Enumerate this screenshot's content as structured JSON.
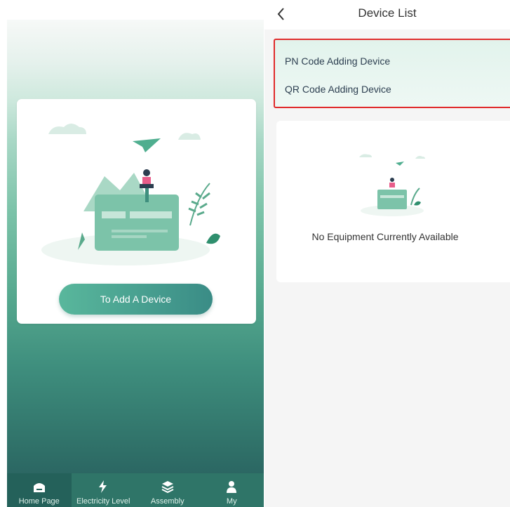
{
  "home": {
    "add_device_label": "To Add A Device",
    "tabs": [
      {
        "label": "Home Page",
        "icon": "home-icon",
        "active": true
      },
      {
        "label": "Electricity Level",
        "icon": "lightning-icon",
        "active": false
      },
      {
        "label": "Assembly",
        "icon": "layers-icon",
        "active": false
      },
      {
        "label": "My",
        "icon": "user-icon",
        "active": false
      }
    ]
  },
  "device_list": {
    "title": "Device List",
    "back_icon": "chevron-left-icon",
    "options": [
      {
        "label": "PN Code Adding Device",
        "chevron": ">"
      },
      {
        "label": "QR Code Adding Device",
        "chevron": ">"
      }
    ],
    "empty_text": "No Equipment Currently Available"
  },
  "colors": {
    "brand_green": "#3a8c86",
    "highlight_border": "#e02b2b"
  }
}
